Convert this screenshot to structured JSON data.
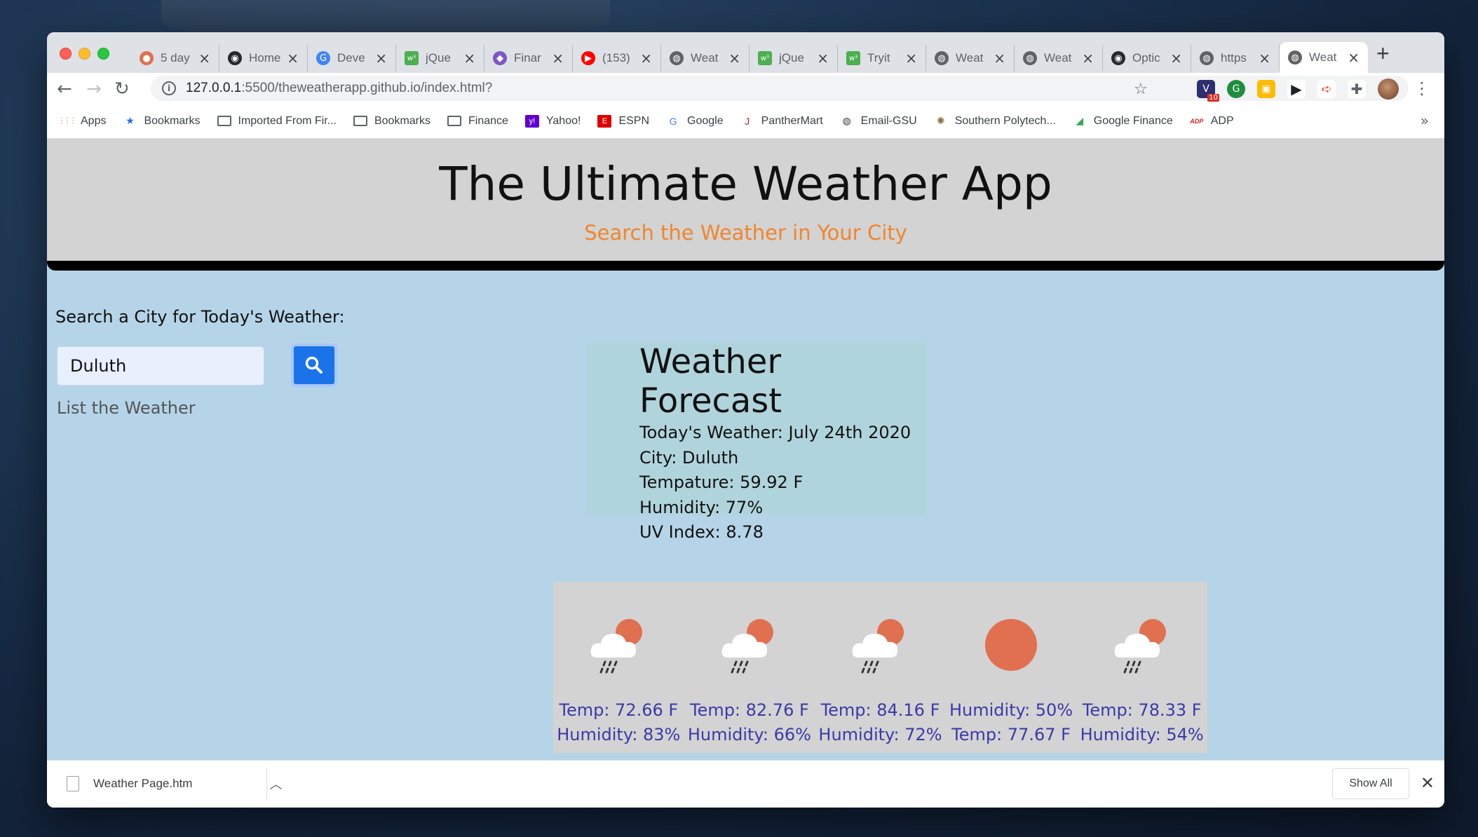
{
  "browser": {
    "tabs": [
      {
        "label": "5 day",
        "icon": "weather-favicon-icon",
        "color": "#e07050"
      },
      {
        "label": "Home",
        "icon": "github-icon",
        "color": "#24292e"
      },
      {
        "label": "Deve",
        "icon": "google-icon",
        "color": "#4285f4"
      },
      {
        "label": "jQue",
        "icon": "w3schools-icon",
        "color": "#4caf50"
      },
      {
        "label": "Finar",
        "icon": "diamond-icon",
        "color": "#7e57c2"
      },
      {
        "label": "(153)",
        "icon": "youtube-icon",
        "color": "#ff0000"
      },
      {
        "label": "Weat",
        "icon": "globe-icon",
        "color": "#5f6368"
      },
      {
        "label": "jQue",
        "icon": "w3schools-icon",
        "color": "#4caf50"
      },
      {
        "label": "Tryit",
        "icon": "w3schools-icon",
        "color": "#4caf50"
      },
      {
        "label": "Weat",
        "icon": "globe-icon",
        "color": "#5f6368"
      },
      {
        "label": "Weat",
        "icon": "globe-icon",
        "color": "#5f6368"
      },
      {
        "label": "Optic",
        "icon": "github-icon",
        "color": "#24292e"
      },
      {
        "label": "https",
        "icon": "globe-icon",
        "color": "#5f6368"
      },
      {
        "label": "Weat",
        "icon": "globe-icon",
        "color": "#5f6368",
        "active": true
      }
    ],
    "url_host": "127.0.0.1",
    "url_path": ":5500/theweatherapp.github.io/index.html?",
    "bookmarks": [
      {
        "label": "Apps",
        "icon": "apps-grid-icon"
      },
      {
        "label": "Bookmarks",
        "icon": "star-icon"
      },
      {
        "label": "Imported From Fir...",
        "icon": "folder-icon"
      },
      {
        "label": "Bookmarks",
        "icon": "folder-icon"
      },
      {
        "label": "Finance",
        "icon": "folder-icon"
      },
      {
        "label": "Yahoo!",
        "icon": "yahoo-icon"
      },
      {
        "label": "ESPN",
        "icon": "espn-icon"
      },
      {
        "label": "Google",
        "icon": "google-icon"
      },
      {
        "label": "PantherMart",
        "icon": "panthermart-icon"
      },
      {
        "label": "Email-GSU",
        "icon": "globe-icon"
      },
      {
        "label": "Southern Polytech...",
        "icon": "seal-icon"
      },
      {
        "label": "Google Finance",
        "icon": "google-finance-icon"
      },
      {
        "label": "ADP",
        "icon": "adp-icon"
      }
    ],
    "ext_badge": "10"
  },
  "app": {
    "title": "The Ultimate Weather App",
    "subtitle": "Search the Weather in Your City",
    "search_label": "Search a City for Today's Weather:",
    "search_value": "Duluth",
    "list_link": "List the Weather",
    "forecast": {
      "heading": "Weather Forecast",
      "lines": [
        "Today's Weather: July 24th 2020",
        "City: Duluth",
        "Tempature: 59.92 F",
        "Humidity: 77%",
        "UV Index: 8.78"
      ]
    },
    "five_day": [
      {
        "icon": "rain-cloud-sun-icon",
        "line1": "Temp: 72.66 F",
        "line2": "Humidity: 83%"
      },
      {
        "icon": "rain-cloud-sun-icon",
        "line1": "Temp: 82.76 F",
        "line2": "Humidity: 66%"
      },
      {
        "icon": "rain-cloud-sun-icon",
        "line1": "Temp: 84.16 F",
        "line2": "Humidity: 72%"
      },
      {
        "icon": "sun-icon",
        "line1": "Humidity: 50%",
        "line2": "Temp: 77.67 F"
      },
      {
        "icon": "rain-cloud-sun-icon",
        "line1": "Temp: 78.33 F",
        "line2": "Humidity: 54%"
      }
    ]
  },
  "downloads": {
    "file": "Weather Page.htm",
    "show_all": "Show All"
  },
  "colors": {
    "hero_bg": "#d3d3d3",
    "page_bg": "#b5d4e8",
    "subtitle": "#f0852d",
    "forecast_text": "#3b3aa8",
    "search_button": "#1a73e8",
    "sun": "#e07050"
  }
}
